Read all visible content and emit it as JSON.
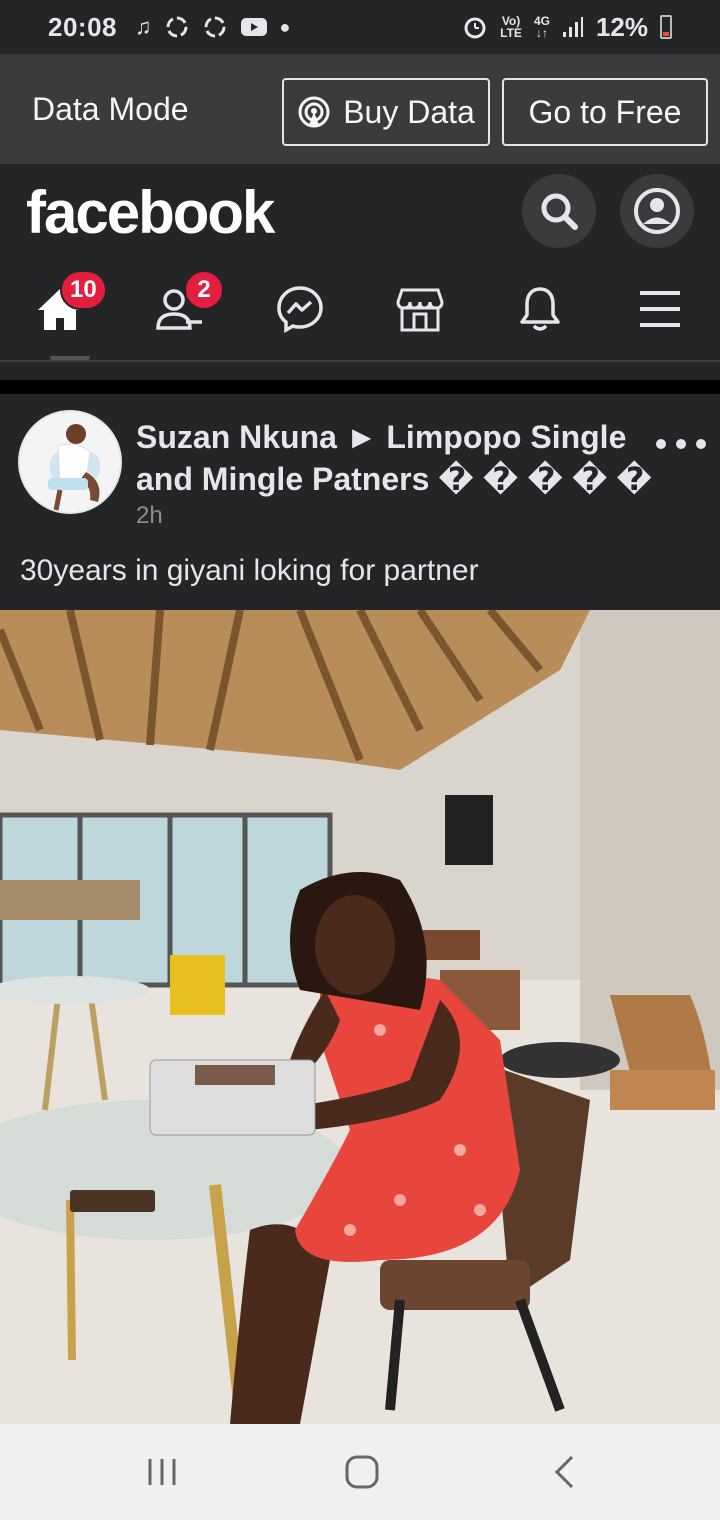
{
  "status_bar": {
    "time": "20:08",
    "battery": "12%",
    "signal_top": "Vo)",
    "signal_bottom": "LTE",
    "net_top": "4G",
    "net_bottom": "↓↑"
  },
  "data_mode": {
    "label": "Data Mode",
    "buy_label": "Buy Data",
    "free_label": "Go to Free"
  },
  "header": {
    "logo": "facebook"
  },
  "nav": {
    "home_badge": "10",
    "friends_badge": "2"
  },
  "post": {
    "author": "Suzan Nkuna ► Limpopo Single and Mingle Patners � � � � �",
    "time": "2h",
    "text": "30years in giyani loking for partner"
  },
  "colors": {
    "background": "#242526",
    "databar": "#3a3b3c",
    "badge": "#e41e3f",
    "text": "#e4e6eb",
    "secondary_text": "#8a8d91"
  }
}
